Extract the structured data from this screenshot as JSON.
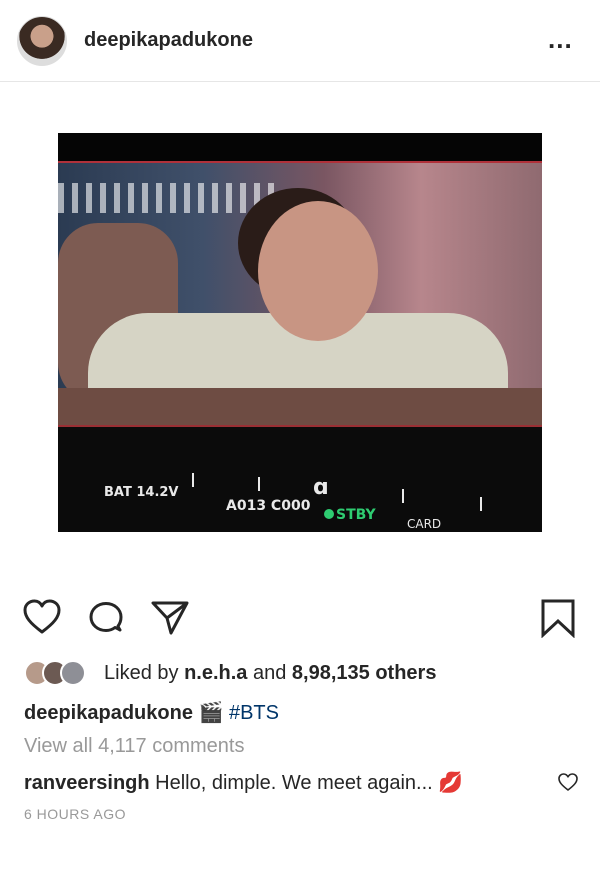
{
  "header": {
    "username": "deepikapadukone",
    "more_label": "..."
  },
  "photo": {
    "hud": {
      "battery": "BAT 14.2V",
      "clip": "A013 C000",
      "status": "STBY",
      "card": "CARD"
    }
  },
  "actions": {
    "like_icon": "heart-icon",
    "comment_icon": "comment-icon",
    "share_icon": "share-icon",
    "save_icon": "bookmark-icon"
  },
  "likes": {
    "prefix": "Liked by",
    "liker": "n.e.h.a",
    "and": "and",
    "count_text": "8,98,135 others"
  },
  "caption": {
    "username": "deepikapadukone",
    "emoji": "🎬",
    "hashtag": "#BTS"
  },
  "comments": {
    "view_all": "View all 4,117 comments",
    "items": [
      {
        "username": "ranveersingh",
        "text": "Hello, dimple. We meet again...",
        "emoji": "💋"
      }
    ]
  },
  "timestamp": "6 HOURS AGO",
  "colors": {
    "text": "#262626",
    "muted": "#999999",
    "hashtag": "#003569",
    "stby": "#2ecc71"
  }
}
